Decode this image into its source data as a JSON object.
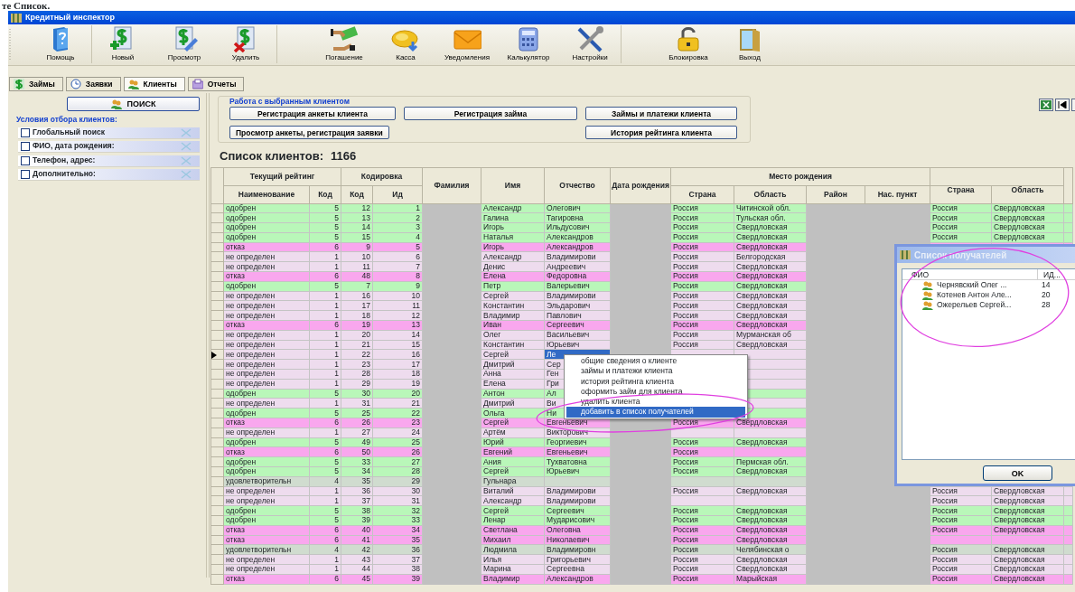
{
  "doc_fragment": "те Список.",
  "window": {
    "title": "Кредитный инспектор"
  },
  "toolbar": [
    [
      "Помощь"
    ],
    [
      "Новый",
      "Просмотр",
      "Удалить"
    ],
    [
      "Погашение",
      "Касса",
      "Уведомления",
      "Калькулятор",
      "Настройки"
    ],
    [
      "Блокировка",
      "Выход"
    ]
  ],
  "tabs": [
    {
      "label": "Займы",
      "selected": false
    },
    {
      "label": "Заявки",
      "selected": false
    },
    {
      "label": "Клиенты",
      "selected": true
    },
    {
      "label": "Отчеты",
      "selected": false
    }
  ],
  "search_button": "ПОИСК",
  "filter": {
    "title": "Условия отбора клиентов:",
    "items": [
      {
        "label": "Глобальный поиск",
        "checked": false
      },
      {
        "label": "ФИО, дата рождения:",
        "checked": false
      },
      {
        "label": "Телефон, адрес:",
        "checked": false
      },
      {
        "label": "Дополнительно:",
        "checked": false
      }
    ]
  },
  "actions": {
    "title": "Работа с выбранным клиентом",
    "rows": [
      [
        "Регистрация анкеты клиента",
        "Регистрация займа",
        "Займы и платежи клиента"
      ],
      [
        "Просмотр анкеты, регистрация заявки",
        "",
        "История рейтинга клиента"
      ]
    ]
  },
  "list_title": "Список клиентов:",
  "list_count": "1166",
  "table": {
    "header_groups": [
      {
        "label": "Текущий рейтинг",
        "columns": [
          "Наименование",
          "Код"
        ]
      },
      {
        "label": "Кодировка",
        "columns": [
          "Код",
          "Ид"
        ]
      },
      {
        "label": "Фамилия"
      },
      {
        "label": "Имя"
      },
      {
        "label": "Отчество"
      },
      {
        "label": "Дата рождения"
      },
      {
        "label": "Место рождения",
        "columns": [
          "Страна",
          "Область",
          "Район",
          "Нас. пункт"
        ]
      },
      {
        "columns": [
          "Страна",
          "Область"
        ]
      }
    ],
    "rows": [
      {
        "kind": "approved",
        "selected": false,
        "rating": "одобрен",
        "code": "5",
        "kod": "12",
        "id": "1",
        "name": "Александр",
        "patronymic": "Олегович",
        "country": "Россия",
        "region": "Читинской обл.",
        "country2": "Россия",
        "region2": "Свердловская"
      },
      {
        "kind": "approved",
        "selected": false,
        "rating": "одобрен",
        "code": "5",
        "kod": "13",
        "id": "2",
        "name": "Галина",
        "patronymic": "Тагировна",
        "country": "Россия",
        "region": "Тульская обл.",
        "country2": "Россия",
        "region2": "Свердловская"
      },
      {
        "kind": "approved",
        "selected": false,
        "rating": "одобрен",
        "code": "5",
        "kod": "14",
        "id": "3",
        "name": "Игорь",
        "patronymic": "Ильдусович",
        "country": "Россия",
        "region": "Свердловская",
        "country2": "Россия",
        "region2": "Свердловская"
      },
      {
        "kind": "approved",
        "selected": false,
        "rating": "одобрен",
        "code": "5",
        "kod": "15",
        "id": "4",
        "name": "Наталья",
        "patronymic": "Александров",
        "country": "Россия",
        "region": "Свердловская",
        "country2": "Россия",
        "region2": "Свердловская"
      },
      {
        "kind": "refused",
        "selected": false,
        "rating": "отказ",
        "code": "6",
        "kod": "9",
        "id": "5",
        "name": "Игорь",
        "patronymic": "Александров",
        "country": "Россия",
        "region": "Свердловская"
      },
      {
        "kind": "undefined",
        "selected": false,
        "rating": "не определен",
        "code": "1",
        "kod": "10",
        "id": "6",
        "name": "Александр",
        "patronymic": "Владимирови",
        "country": "Россия",
        "region": "Белгородская"
      },
      {
        "kind": "undefined",
        "selected": false,
        "rating": "не определен",
        "code": "1",
        "kod": "11",
        "id": "7",
        "name": "Денис",
        "patronymic": "Андреевич",
        "country": "Россия",
        "region": "Свердловская"
      },
      {
        "kind": "refused",
        "selected": false,
        "rating": "отказ",
        "code": "6",
        "kod": "48",
        "id": "8",
        "name": "Елена",
        "patronymic": "Федоровна",
        "country": "Россия",
        "region": "Свердловская"
      },
      {
        "kind": "approved",
        "selected": false,
        "rating": "одобрен",
        "code": "5",
        "kod": "7",
        "id": "9",
        "name": "Петр",
        "patronymic": "Валерьевич",
        "country": "Россия",
        "region": "Свердловская"
      },
      {
        "kind": "undefined",
        "selected": false,
        "rating": "не определен",
        "code": "1",
        "kod": "16",
        "id": "10",
        "name": "Сергей",
        "patronymic": "Владимирови",
        "country": "Россия",
        "region": "Свердловская"
      },
      {
        "kind": "undefined",
        "selected": false,
        "rating": "не определен",
        "code": "1",
        "kod": "17",
        "id": "11",
        "name": "Константин",
        "patronymic": "Эльдарович",
        "country": "Россия",
        "region": "Свердловская"
      },
      {
        "kind": "undefined",
        "selected": false,
        "rating": "не определен",
        "code": "1",
        "kod": "18",
        "id": "12",
        "name": "Владимир",
        "patronymic": "Павлович",
        "country": "Россия",
        "region": "Свердловская"
      },
      {
        "kind": "refused",
        "selected": false,
        "rating": "отказ",
        "code": "6",
        "kod": "19",
        "id": "13",
        "name": "Иван",
        "patronymic": "Сергеевич",
        "country": "Россия",
        "region": "Свердловская"
      },
      {
        "kind": "undefined",
        "selected": false,
        "rating": "не определен",
        "code": "1",
        "kod": "20",
        "id": "14",
        "name": "Олег",
        "patronymic": "Васильевич",
        "country": "Россия",
        "region": "Мурманская об"
      },
      {
        "kind": "undefined",
        "selected": false,
        "rating": "не определен",
        "code": "1",
        "kod": "21",
        "id": "15",
        "name": "Константин",
        "patronymic": "Юрьевич",
        "country": "Россия",
        "region": "Свердловская"
      },
      {
        "kind": "undefined",
        "selected": true,
        "rating": "не определен",
        "code": "1",
        "kod": "22",
        "id": "16",
        "name": "Сергей",
        "patronymic": "Ле"
      },
      {
        "kind": "undefined",
        "selected": false,
        "rating": "не определен",
        "code": "1",
        "kod": "23",
        "id": "17",
        "name": "Дмитрий",
        "patronymic": "Сер"
      },
      {
        "kind": "undefined",
        "selected": false,
        "rating": "не определен",
        "code": "1",
        "kod": "28",
        "id": "18",
        "name": "Анна",
        "patronymic": "Ген"
      },
      {
        "kind": "undefined",
        "selected": false,
        "rating": "не определен",
        "code": "1",
        "kod": "29",
        "id": "19",
        "name": "Елена",
        "patronymic": "Гри"
      },
      {
        "kind": "approved",
        "selected": false,
        "rating": "одобрен",
        "code": "5",
        "kod": "30",
        "id": "20",
        "name": "Антон",
        "patronymic": "Ал"
      },
      {
        "kind": "undefined",
        "selected": false,
        "rating": "не определен",
        "code": "1",
        "kod": "31",
        "id": "21",
        "name": "Дмитрий",
        "patronymic": "Ви"
      },
      {
        "kind": "approved",
        "selected": false,
        "rating": "одобрен",
        "code": "5",
        "kod": "25",
        "id": "22",
        "name": "Ольга",
        "patronymic": "Ни"
      },
      {
        "kind": "refused",
        "selected": false,
        "rating": "отказ",
        "code": "6",
        "kod": "26",
        "id": "23",
        "name": "Сергей",
        "patronymic": "Евгеньевич",
        "country": "Россия",
        "region": "Свердловская"
      },
      {
        "kind": "undefined",
        "selected": false,
        "rating": "не определен",
        "code": "1",
        "kod": "27",
        "id": "24",
        "name": "Артём",
        "patronymic": "Викторович"
      },
      {
        "kind": "approved",
        "selected": false,
        "rating": "одобрен",
        "code": "5",
        "kod": "49",
        "id": "25",
        "name": "Юрий",
        "patronymic": "Георгиевич",
        "country": "Россия",
        "region": "Свердловская"
      },
      {
        "kind": "refused",
        "selected": false,
        "rating": "отказ",
        "code": "6",
        "kod": "50",
        "id": "26",
        "name": "Евгений",
        "patronymic": "Евгеньевич",
        "country": "Россия"
      },
      {
        "kind": "approved",
        "selected": false,
        "rating": "одобрен",
        "code": "5",
        "kod": "33",
        "id": "27",
        "name": "Ания",
        "patronymic": "Тухватовна",
        "country": "Россия",
        "region": "Пермская обл."
      },
      {
        "kind": "approved",
        "selected": false,
        "rating": "одобрен",
        "code": "5",
        "kod": "34",
        "id": "28",
        "name": "Сергей",
        "patronymic": "Юрьевич",
        "country": "Россия",
        "region": "Свердловская"
      },
      {
        "kind": "satisfactory",
        "selected": false,
        "rating": "удовлетворительн",
        "code": "4",
        "kod": "35",
        "id": "29",
        "name": "Гульнара"
      },
      {
        "kind": "undefined",
        "selected": false,
        "rating": "не определен",
        "code": "1",
        "kod": "36",
        "id": "30",
        "name": "Виталий",
        "patronymic": "Владимирови",
        "country": "Россия",
        "region": "Свердловская",
        "country2": "Россия",
        "region2": "Свердловская"
      },
      {
        "kind": "undefined",
        "selected": false,
        "rating": "не определен",
        "code": "1",
        "kod": "37",
        "id": "31",
        "name": "Александр",
        "patronymic": "Владимирови",
        "country2": "Россия",
        "region2": "Свердловская"
      },
      {
        "kind": "approved",
        "selected": false,
        "rating": "одобрен",
        "code": "5",
        "kod": "38",
        "id": "32",
        "name": "Сергей",
        "patronymic": "Сергеевич",
        "country": "Россия",
        "region": "Свердловская",
        "country2": "Россия",
        "region2": "Свердловская"
      },
      {
        "kind": "approved",
        "selected": false,
        "rating": "одобрен",
        "code": "5",
        "kod": "39",
        "id": "33",
        "name": "Ленар",
        "patronymic": "Мударисович",
        "country": "Россия",
        "region": "Свердловская",
        "country2": "Россия",
        "region2": "Свердловская"
      },
      {
        "kind": "refused",
        "selected": false,
        "rating": "отказ",
        "code": "6",
        "kod": "40",
        "id": "34",
        "name": "Светлана",
        "patronymic": "Олеговна",
        "country": "Россия",
        "region": "Свердловская",
        "country2": "Россия",
        "region2": "Свердловская"
      },
      {
        "kind": "refused",
        "selected": false,
        "rating": "отказ",
        "code": "6",
        "kod": "41",
        "id": "35",
        "name": "Михаил",
        "patronymic": "Николаевич",
        "country": "Россия",
        "region": "Свердловская"
      },
      {
        "kind": "satisfactory",
        "selected": false,
        "rating": "удовлетворительн",
        "code": "4",
        "kod": "42",
        "id": "36",
        "name": "Людмила",
        "patronymic": "Владимировн",
        "country": "Россия",
        "region": "Челябинская о",
        "country2": "Россия",
        "region2": "Свердловская"
      },
      {
        "kind": "undefined",
        "selected": false,
        "rating": "не определен",
        "code": "1",
        "kod": "43",
        "id": "37",
        "name": "Илья",
        "patronymic": "Григорьевич",
        "country": "Россия",
        "region": "Свердловская",
        "country2": "Россия",
        "region2": "Свердловская"
      },
      {
        "kind": "undefined",
        "selected": false,
        "rating": "не определен",
        "code": "1",
        "kod": "44",
        "id": "38",
        "name": "Марина",
        "patronymic": "Сергеевна",
        "country": "Россия",
        "region": "Свердловская",
        "country2": "Россия",
        "region2": "Свердловская"
      },
      {
        "kind": "refused",
        "selected": false,
        "rating": "отказ",
        "code": "6",
        "kod": "45",
        "id": "39",
        "name": "Владимир",
        "patronymic": "Александров",
        "country": "Россия",
        "region": "Марыйская",
        "country2": "Россия",
        "region2": "Свердловская"
      }
    ]
  },
  "context_menu": [
    {
      "label": "общие сведения о клиенте",
      "selected": false
    },
    {
      "label": "займы и платежи клиента",
      "selected": false
    },
    {
      "label": "история рейтинга клиента",
      "selected": false
    },
    {
      "label": "оформить займ для клиента",
      "selected": false
    },
    {
      "label": "удалить клиента",
      "selected": false
    },
    {
      "label": "добавить в список получателей",
      "selected": true
    }
  ],
  "dialog": {
    "title": "Список получателей",
    "columns": [
      "ФИО",
      "ИД..."
    ],
    "items": [
      {
        "fio": "Чернявский Олег ...",
        "id": "14"
      },
      {
        "fio": "Котенев Антон Але...",
        "id": "20"
      },
      {
        "fio": "Ожерельев Сергей...",
        "id": "28"
      }
    ],
    "ok": "OK"
  }
}
